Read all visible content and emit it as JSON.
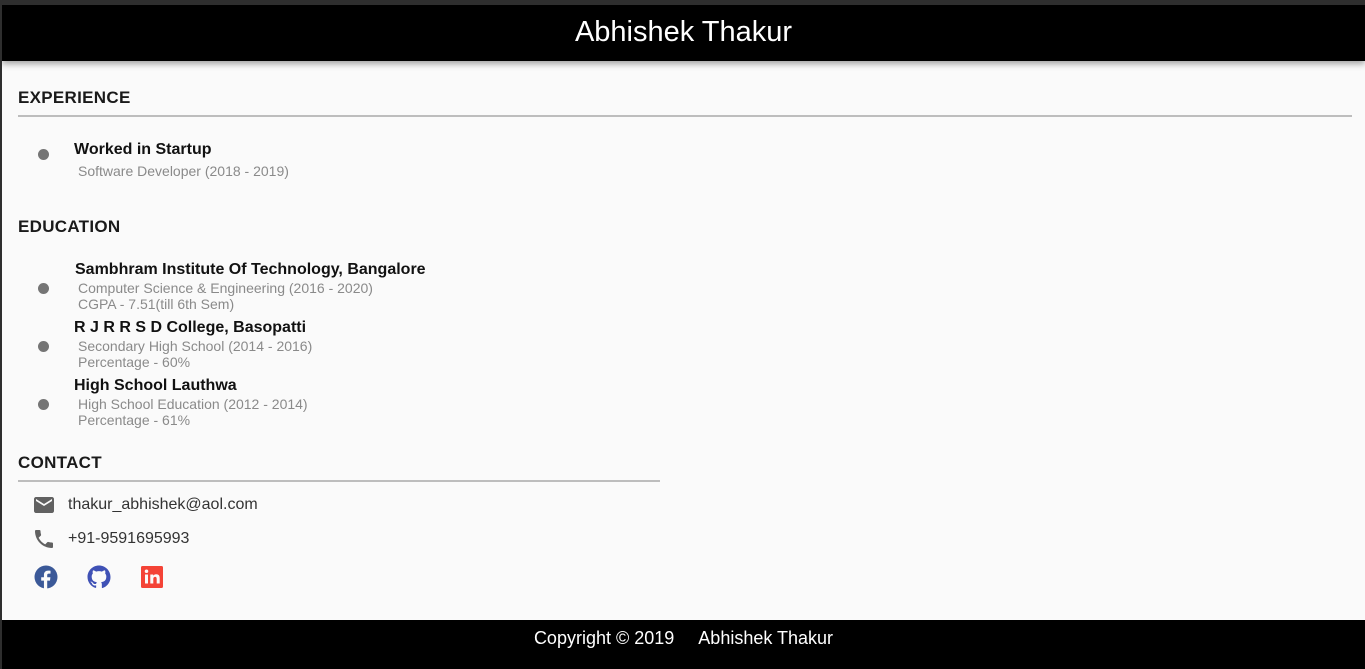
{
  "header": {
    "title": "Abhishek Thakur"
  },
  "experience": {
    "heading": "EXPERIENCE",
    "items": [
      {
        "title": "Worked in Startup",
        "lines": [
          "Software Developer (2018 - 2019)"
        ]
      }
    ]
  },
  "education": {
    "heading": "EDUCATION",
    "items": [
      {
        "title": "Sambhram Institute Of Technology, Bangalore",
        "lines": [
          "Computer Science & Engineering (2016 - 2020)",
          "CGPA - 7.51(till 6th Sem)"
        ]
      },
      {
        "title": "R J R R S D College, Basopatti",
        "lines": [
          "Secondary High School (2014 - 2016)",
          "Percentage - 60%"
        ]
      },
      {
        "title": "High School Lauthwa",
        "lines": [
          "High School Education (2012 - 2014)",
          "Percentage - 61%"
        ]
      }
    ]
  },
  "contact": {
    "heading": "CONTACT",
    "email": "thakur_abhishek@aol.com",
    "phone": "+91-9591695993",
    "icons": {
      "email": "email-icon",
      "phone": "phone-icon"
    },
    "social": [
      {
        "name": "facebook-icon",
        "color": "#3b5998"
      },
      {
        "name": "github-icon",
        "color": "#3f51b5"
      },
      {
        "name": "linkedin-icon",
        "color": "#f44336"
      }
    ]
  },
  "footer": {
    "copyright": "Copyright © 2019",
    "name": "Abhishek Thakur"
  },
  "colors": {
    "header_bg": "#000000",
    "page_bg": "#fafafa",
    "subtext": "#8a8a8a",
    "bullet": "#757575",
    "rule": "#bdbdbd"
  }
}
